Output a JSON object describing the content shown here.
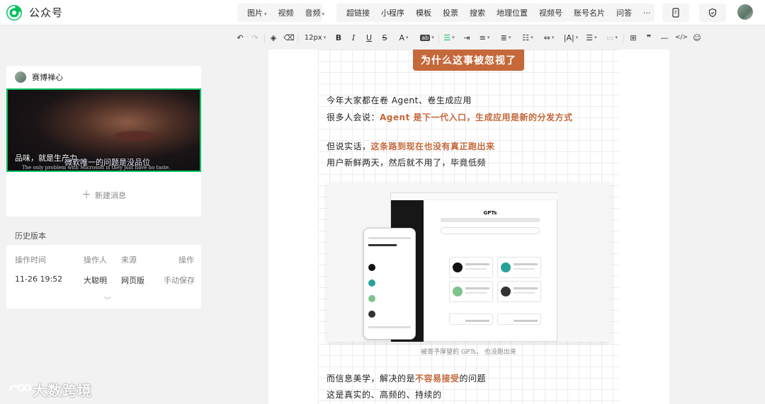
{
  "app": {
    "name": "公众号",
    "brand_color": "#07c160"
  },
  "insert_menu": {
    "media": [
      {
        "label": "图片",
        "dropdown": true
      },
      {
        "label": "视频",
        "dropdown": false
      },
      {
        "label": "音频",
        "dropdown": true
      }
    ],
    "items": [
      "超链接",
      "小程序",
      "模板",
      "投票",
      "搜索",
      "地理位置",
      "视频号",
      "账号名片",
      "问答"
    ],
    "more": "···"
  },
  "format_toolbar": {
    "font_size": "12px"
  },
  "left_panel": {
    "author": "赛博禅心",
    "thumbnail_subtitles": [
      "品味，就是生产力",
      "微软唯一的问题是没品位",
      "The only problem with Microsoft is they just have no taste."
    ],
    "new_message": "新建消息"
  },
  "history": {
    "title": "历史版本",
    "columns": [
      "操作时间",
      "操作人",
      "来源",
      "操作"
    ],
    "rows": [
      {
        "time": "11-26 19:52",
        "operator": "大聪明",
        "source": "网页版",
        "action": "手动保存"
      }
    ]
  },
  "article": {
    "heading": "为什么这事被忽视了",
    "lines": [
      {
        "pre": "今年大家都在卷 Agent、卷生成应用",
        "hl": "",
        "post": ""
      },
      {
        "pre": "很多人会说：",
        "hl": "Agent 是下一代入口，生成应用是新的分发方式",
        "post": ""
      },
      {
        "pre": "但说实话，",
        "hl": "这条路到现在也没有真正跑出来",
        "post": ""
      },
      {
        "pre": "用户新鲜两天，然后就不用了，毕竟低频",
        "hl": "",
        "post": ""
      },
      {
        "pre": "而信息美学，解决的是",
        "hl": "不容易接受",
        "post": "的问题"
      },
      {
        "pre": "这是真实的、高频的、持续的",
        "hl": "",
        "post": ""
      }
    ],
    "figure": {
      "title": "GPTs",
      "caption": "被寄予厚望的 GPTs， 也没跑出来"
    },
    "highlight_color": "#c5683a"
  },
  "watermark": "大数跨境"
}
